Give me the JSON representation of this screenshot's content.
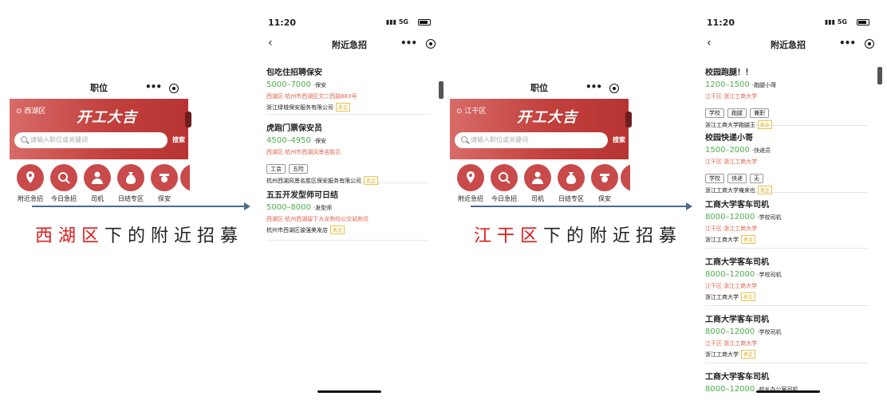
{
  "left_mini": {
    "title": "职位",
    "location": "西湖区",
    "banner_text": "开工大吉",
    "search_placeholder": "请输入职位或关键词",
    "search_button": "搜索",
    "categories": [
      "附近急招",
      "今日急招",
      "司机",
      "日结专区",
      "保安"
    ]
  },
  "left_caption": {
    "red": "西湖区",
    "rest": "下的附近招募"
  },
  "left_phone": {
    "time": "11:20",
    "signal": "5G",
    "title": "附近急招",
    "jobs": [
      {
        "title": "包吃住招聘保安",
        "salary": "5000–7000",
        "category": "保安",
        "address": "西湖区·杭州市西湖区文二西路683号",
        "tags": [],
        "company": "浙江绿城保安服务有限公司",
        "badge": "名企"
      },
      {
        "title": "虎跑门票保安员",
        "salary": "4500–4950",
        "category": "保安",
        "address": "西湖区·杭州市西湖风景名胜区",
        "tags": [
          "工会",
          "五险"
        ],
        "company": "杭州西湖风景名胜区保安服务有限公司",
        "badge": "名企"
      },
      {
        "title": "五五开发型师可日结",
        "salary": "5000–8000",
        "category": "发型师",
        "address": "西湖区·杭州西湖留下大龙狗均公交站附近",
        "tags": [],
        "company": "杭州市西湖区骏强美发店",
        "badge": "名企"
      }
    ]
  },
  "right_mini": {
    "title": "职位",
    "location": "江干区",
    "banner_text": "开工大吉",
    "search_placeholder": "请输入职位或关键词",
    "search_button": "搜索",
    "categories": [
      "附近急招",
      "今日急招",
      "司机",
      "日结专区",
      "保安"
    ]
  },
  "right_caption": {
    "red": "江干区",
    "rest": "下的附近招募"
  },
  "right_phone": {
    "time": "11:20",
    "signal": "5G",
    "title": "附近急招",
    "jobs": [
      {
        "title": "校园跑腿！！",
        "salary": "1200–1500",
        "category": "跑腿小哥",
        "address": "江干区·浙江工商大学",
        "tags": [
          "学校",
          "跑腿",
          "兼职"
        ],
        "company": "浙江工商大学跑腿王",
        "badge": "名企"
      },
      {
        "title": "校园快递小哥",
        "salary": "1500–2000",
        "category": "快递员",
        "address": "江干区·浙江工商大学",
        "tags": [
          "学校",
          "快递",
          "无"
        ],
        "company": "浙江工商大学俺来也",
        "badge": "名企"
      },
      {
        "title": "工商大学客车司机",
        "salary": "8000–12000",
        "category": "学校司机",
        "address": "江干区·浙江工商大学",
        "tags": [],
        "company": "浙江工商大学",
        "badge": "名企"
      },
      {
        "title": "工商大学客车司机",
        "salary": "8000–12000",
        "category": "学校司机",
        "address": "江干区·浙江工商大学",
        "tags": [],
        "company": "浙江工商大学",
        "badge": "名企"
      },
      {
        "title": "工商大学客车司机",
        "salary": "8000–12000",
        "category": "学校司机",
        "address": "江干区·浙江工商大学",
        "tags": [],
        "company": "浙江工商大学",
        "badge": "名企"
      },
      {
        "title": "工商大学客车司机",
        "salary": "8000–12000",
        "category": "校长办公室司机",
        "address": "",
        "tags": [],
        "company": "",
        "badge": ""
      }
    ]
  }
}
